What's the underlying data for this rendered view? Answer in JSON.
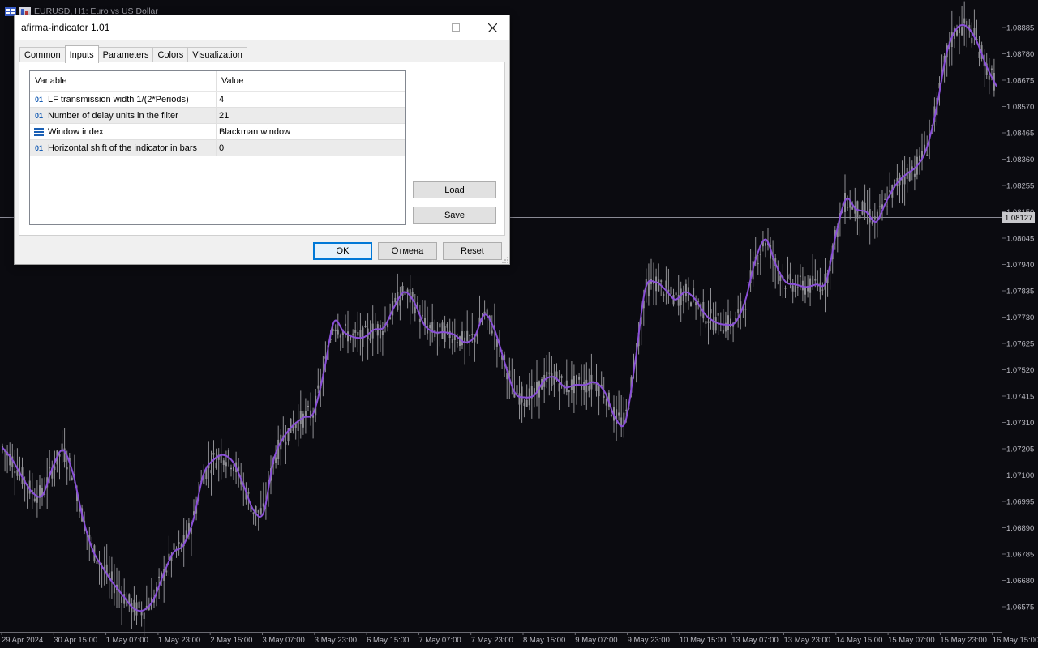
{
  "chart": {
    "symbol_title": "EURUSD, H1:  Euro vs US Dollar",
    "current_price": "1.08127",
    "colors": {
      "background": "#0b0b10",
      "candles": "#8f8f94",
      "indicator": "#8a4fd8",
      "crosshair": "#8a8a95",
      "axis_text": "#b8b8c0"
    }
  },
  "chart_data": {
    "type": "line",
    "y_ticks": [
      "1.08885",
      "1.08780",
      "1.08675",
      "1.08570",
      "1.08465",
      "1.08360",
      "1.08255",
      "1.08150",
      "1.08045",
      "1.07940",
      "1.07835",
      "1.07730",
      "1.07625",
      "1.07520",
      "1.07415",
      "1.07310",
      "1.07205",
      "1.07100",
      "1.06995",
      "1.06890",
      "1.06785",
      "1.06680",
      "1.06575"
    ],
    "x_ticks": [
      "29 Apr 2024",
      "30 Apr 15:00",
      "1 May 07:00",
      "1 May 23:00",
      "2 May 15:00",
      "3 May 07:00",
      "3 May 23:00",
      "6 May 15:00",
      "7 May 07:00",
      "7 May 23:00",
      "8 May 15:00",
      "9 May 07:00",
      "9 May 23:00",
      "10 May 15:00",
      "13 May 07:00",
      "13 May 23:00",
      "14 May 15:00",
      "15 May 07:00",
      "15 May 23:00",
      "16 May 15:00"
    ],
    "ylim": [
      1.0654,
      1.0895
    ],
    "series": [
      {
        "values": [
          1.0721,
          1.0716,
          1.0709,
          1.0703,
          1.0702,
          1.0713,
          1.072,
          1.0711,
          1.0693,
          1.068,
          1.0673,
          1.0667,
          1.0662,
          1.0657,
          1.0656,
          1.066,
          1.067,
          1.0679,
          1.0682,
          1.0692,
          1.071,
          1.0716,
          1.0718,
          1.0715,
          1.0706,
          1.0696,
          1.0695,
          1.0716,
          1.0725,
          1.073,
          1.0733,
          1.0735,
          1.0751,
          1.0771,
          1.0767,
          1.0765,
          1.0765,
          1.0768,
          1.0769,
          1.0777,
          1.0783,
          1.0779,
          1.077,
          1.0767,
          1.0767,
          1.0766,
          1.0763,
          1.0765,
          1.0774,
          1.0768,
          1.0755,
          1.0743,
          1.0741,
          1.0742,
          1.0748,
          1.0749,
          1.0745,
          1.0746,
          1.0746,
          1.0747,
          1.0743,
          1.0733,
          1.0731,
          1.0755,
          1.0784,
          1.0787,
          1.0784,
          1.078,
          1.0783,
          1.078,
          1.0774,
          1.0771,
          1.077,
          1.0771,
          1.078,
          1.0796,
          1.0804,
          1.0794,
          1.0787,
          1.0786,
          1.0785,
          1.0786,
          1.0787,
          1.0806,
          1.082,
          1.0816,
          1.0815,
          1.0811,
          1.0819,
          1.0826,
          1.083,
          1.0833,
          1.084,
          1.0856,
          1.0878,
          1.0888,
          1.0889,
          1.0883,
          1.0873,
          1.0865
        ]
      }
    ]
  },
  "dialog": {
    "title": "afirma-indicator 1.01",
    "tabs": [
      "Common",
      "Inputs",
      "Parameters",
      "Colors",
      "Visualization"
    ],
    "columns": {
      "variable": "Variable",
      "value": "Value"
    },
    "rows": [
      {
        "icon": "01",
        "variable": "LF transmission width 1/(2*Periods)",
        "value": "4"
      },
      {
        "icon": "01",
        "variable": "Number of delay units in the filter",
        "value": "21"
      },
      {
        "icon": "list-icon",
        "variable": "Window index",
        "value": "Blackman window"
      },
      {
        "icon": "01",
        "variable": "Horizontal shift of the indicator in bars",
        "value": "0"
      }
    ],
    "buttons": {
      "load": "Load",
      "save": "Save",
      "ok": "OK",
      "cancel": "Отмена",
      "reset": "Reset"
    }
  }
}
